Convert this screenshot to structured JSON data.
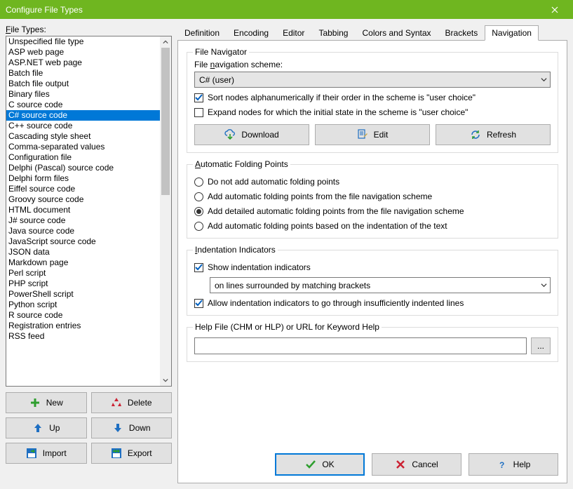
{
  "window": {
    "title": "Configure File Types"
  },
  "left": {
    "label_pre": "",
    "label_underline": "F",
    "label_post": "ile Types:",
    "items": [
      "Unspecified file type",
      "ASP web page",
      "ASP.NET web page",
      "Batch file",
      "Batch file output",
      "Binary files",
      "C source code",
      "C# source code",
      "C++ source code",
      "Cascading style sheet",
      "Comma-separated values",
      "Configuration file",
      "Delphi (Pascal) source code",
      "Delphi form files",
      "Eiffel source code",
      "Groovy source code",
      "HTML document",
      "J# source code",
      "Java source code",
      "JavaScript source code",
      "JSON data",
      "Markdown page",
      "Perl script",
      "PHP script",
      "PowerShell script",
      "Python script",
      "R source code",
      "Registration entries",
      "RSS feed"
    ],
    "selected_index": 7,
    "buttons": {
      "new": "New",
      "delete": "Delete",
      "up": "Up",
      "down": "Down",
      "import": "Import",
      "export": "Export"
    }
  },
  "tabs": {
    "items": [
      "Definition",
      "Encoding",
      "Editor",
      "Tabbing",
      "Colors and Syntax",
      "Brackets",
      "Navigation"
    ],
    "active_index": 6
  },
  "nav": {
    "group1_legend": "File Navigator",
    "scheme_label_pre": "File ",
    "scheme_label_u": "n",
    "scheme_label_post": "avigation scheme:",
    "scheme_value": "C# (user)",
    "sort_label": "Sort nodes alphanumerically if their order in the scheme is \"user choice\"",
    "sort_checked": true,
    "expand_label": "Expand nodes for which the initial state in the scheme is \"user choice\"",
    "expand_checked": false,
    "buttons": {
      "download": "Download",
      "edit": "Edit",
      "refresh": "Refresh"
    }
  },
  "fold": {
    "legend_u": "A",
    "legend_post": "utomatic Folding Points",
    "options": [
      "Do not add automatic folding points",
      "Add automatic folding points from the file navigation scheme",
      "Add detailed automatic folding points from the file navigation scheme",
      "Add automatic folding points based on the indentation of the text"
    ],
    "selected": 2
  },
  "indent": {
    "legend_u": "I",
    "legend_post": "ndentation Indicators",
    "show_label": "Show indentation indicators",
    "show_checked": true,
    "combo_value": "on lines surrounded by matching brackets",
    "allow_label": "Allow indentation indicators to go through insufficiently indented lines",
    "allow_checked": true
  },
  "help": {
    "legend": "Help File (CHM or HLP) or URL for Keyword Help",
    "value": "",
    "browse": "..."
  },
  "footer": {
    "ok": "OK",
    "cancel": "Cancel",
    "help": "Help"
  }
}
